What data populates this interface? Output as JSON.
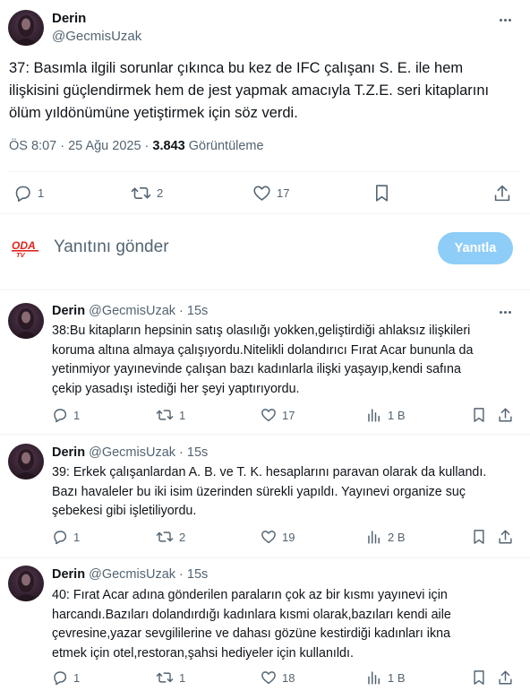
{
  "main_tweet": {
    "author_name": "Derin",
    "author_handle": "@GecmisUzak",
    "text_lines": [
      "37: Basımla ilgili sorunlar çıkınca bu kez de IFC çalışanı S. E. ile hem",
      "ilişkisini güçlendirmek hem de jest yapmak amacıyla T.Z.E. seri kitaplarını",
      "ölüm yıldönümüne yetiştirmek için söz verdi."
    ],
    "time": "ÖS 8:07 · 25 Ağu 2025 · ",
    "views_count": "3.843",
    "views_label": " Görüntüleme",
    "actions": {
      "replies": "1",
      "reposts": "2",
      "likes": "17"
    }
  },
  "compose": {
    "logo_text": "ODA TV",
    "placeholder": "Yanıtını gönder",
    "button_label": "Yanıtla"
  },
  "replies": [
    {
      "name": "Derin",
      "handle": "@GecmisUzak",
      "time": "· 15s",
      "text_lines": [
        "38:Bu kitapların hepsinin satış olasılığı yokken,geliştirdiği ahlaksız ilişkileri",
        "koruma altına almaya çalışıyordu.Nitelikli dolandırıcı Fırat Acar bununla da",
        "yetinmiyor yayınevinde çalışan bazı kadınlarla ilişki yaşayıp,kendi safına",
        "çekip yasadışı istediği her şeyi yaptırıyordu."
      ],
      "actions": {
        "replies": "1",
        "reposts": "1",
        "likes": "17",
        "views": "1 B"
      }
    },
    {
      "name": "Derin",
      "handle": "@GecmisUzak",
      "time": "· 15s",
      "text_lines": [
        "39: Erkek çalışanlardan A. B. ve T. K. hesaplarını paravan olarak da kullandı.",
        "Bazı havaleler bu iki isim üzerinden sürekli yapıldı. Yayınevi organize suç",
        "şebekesi gibi işletiliyordu."
      ],
      "actions": {
        "replies": "1",
        "reposts": "2",
        "likes": "19",
        "views": "2 B"
      }
    },
    {
      "name": "Derin",
      "handle": "@GecmisUzak",
      "time": "· 15s",
      "text_lines": [
        "40: Fırat Acar adına gönderilen paraların çok az bir kısmı yayınevi için",
        "harcandı.Bazıları dolandırdığı kadınlara kısmi olarak,bazıları kendi aile",
        "çevresine,yazar sevgililerine ve dahası gözüne kestirdiği kadınları ikna",
        "etmek için otel,restoran,şahsi hediyeler için kullanıldı."
      ],
      "actions": {
        "replies": "1",
        "reposts": "1",
        "likes": "18",
        "views": "1 B"
      }
    }
  ],
  "colors": {
    "text": "#0f1419",
    "secondary": "#536471",
    "divider": "#eff3f4",
    "reply_button": "#8ecdf7",
    "odatv_red": "#e0241b"
  },
  "icons": [
    "avatar-image",
    "more-icon",
    "reply-icon",
    "repost-icon",
    "like-icon",
    "bookmark-icon",
    "share-icon",
    "views-icon",
    "odatv-logo"
  ]
}
